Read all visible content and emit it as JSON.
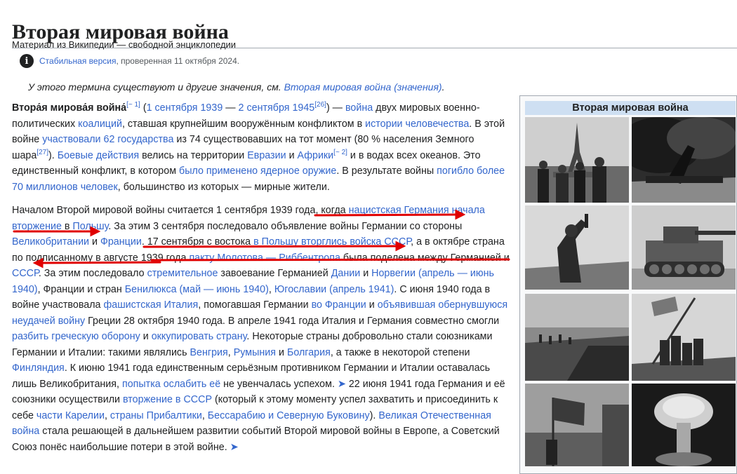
{
  "page": {
    "title": "Вторая мировая война",
    "from_text": "Материал из Википедии — свободной энциклопедии",
    "stable_link": "Стабильная версия",
    "stable_rest": ", проверенная 11 октября 2024.",
    "hatnote_text": "У этого термина существуют и другие значения, см. ",
    "hatnote_link": "Вторая мировая война (значения)",
    "hatnote_end": "."
  },
  "infobox": {
    "title": "Вторая мировая война"
  },
  "annotation_color": "#e00000",
  "p1": {
    "t0": "Втора́я мирова́я война́",
    "r1": "[~ 1]",
    "t1": " (",
    "l1": "1 сентября 1939",
    "t2": " — ",
    "l2": "2 сентября 1945",
    "r2": "[26]",
    "t3": ") — ",
    "l3": "война",
    "t4": " двух мировых военно-политических ",
    "l4": "коалиций",
    "t5": ", ставшая крупнейшим вооружённым конфликтом в ",
    "l5": "истории человечества",
    "t6": ". В этой войне ",
    "l6": "участвовали 62 государства",
    "t7": " из 74 существовавших на тот момент (80 % населения Земного шара",
    "r3": "[27]",
    "t8": "). ",
    "l7": "Боевые действия",
    "t9": " велись на территории ",
    "l8": "Евразии",
    "t10": " и ",
    "l9": "Африки",
    "r4": "[~ 2]",
    "t11": " и в водах всех океанов. Это единственный конфликт, в котором ",
    "l10": "было применено ядерное оружие",
    "t12": ". В результате войны ",
    "l11": "погибло более 70 миллионов человек",
    "t13": ", большинство из которых — мирные жители."
  },
  "p2": {
    "t0": "Началом Второй мировой войны считается 1 сентября 1939 года, когда ",
    "l1": "нацистская Германия начала вторжение",
    "t1": " в ",
    "l2": "Польшу",
    "t2": ". За этим 3 сентября последовало объявление войны Германии со стороны ",
    "l3": "Великобритании",
    "t3": " и ",
    "l4": "Франции",
    "t4": ". 17 сентября с востока ",
    "l5": "в Польшу вторглись войска СССР",
    "t5": ", а в октябре страна по подписанному в августе 1939 года ",
    "l6": "пакту Молотова — Риббентропа",
    "t6": " была поделена между Германией и ",
    "l7": "СССР",
    "t7": ". За этим последовало ",
    "l8": "стремительное",
    "t8": " завоевание Германией ",
    "l9": "Дании",
    "t9": " и ",
    "l10": "Норвегии",
    "t10": " ",
    "l11": "(апрель — июнь 1940)",
    "t11": ", Франции и стран ",
    "l12": "Бенилюкса",
    "t12": " ",
    "l13": "(май — июнь 1940)",
    "t13": ", ",
    "l14": "Югославии",
    "t14": " ",
    "l15": "(апрель 1941)",
    "t15": ". С июня 1940 года в войне участвовала ",
    "l16": "фашистская Италия",
    "t16": ", помогавшая Германии ",
    "l17": "во Франции",
    "t17": " и ",
    "l18": "объявившая обернувшуюся неудачей войну",
    "t18": " Греции 28 октября 1940 года. В апреле 1941 года Италия и Германия совместно смогли ",
    "l19": "разбить греческую оборону",
    "t19": " и ",
    "l20": "оккупировать страну",
    "t20": ". Некоторые страны добровольно стали союзниками Германии и Италии: такими являлись ",
    "l21": "Венгрия",
    "t21": ", ",
    "l22": "Румыния",
    "t22": " и ",
    "l23": "Болгария",
    "t23": ", а также в некоторой степени ",
    "l24": "Финляндия",
    "t24": ". К июню 1941 года единственным серьёзным противником Германии и Италии оставалась лишь Великобритания, ",
    "l25": "попытка ослабить её",
    "t25": " не увенчалась успехом. ",
    "a1": "➤",
    "t26": " 22 июня 1941 года Германия и её союзники осуществили ",
    "l26": "вторжение в СССР",
    "t27": " (который к этому моменту успел захватить и присоединить к себе ",
    "l27": "части Карелии",
    "t28": ", ",
    "l28": "страны Прибалтики",
    "t29": ", ",
    "l29": "Бессарабию и Северную Буковину",
    "t30": "). ",
    "l30": "Великая Отечественная война",
    "t31": " стала решающей в дальнейшем развитии событий Второй мировой войны в Европе, а Советский Союз понёс наибольшие потери в этой войне. ",
    "a2": "➤"
  }
}
